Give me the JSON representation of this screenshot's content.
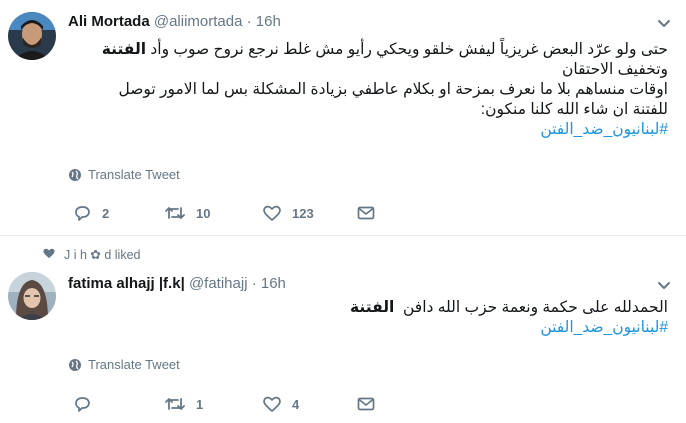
{
  "tweets": [
    {
      "name": "Ali Mortada",
      "handle": "@aliimortada",
      "time": "16h",
      "line1_prefix": "حتى ولو عرّد البعض غريزياً ليفش خلقو ويحكي رأيو مش غلط نرجع نروح صوب وأد",
      "line1_bold": "الفتنة",
      "line2": "وتخفيف الاحتقان",
      "line3": "اوقات منساهم بلا ما نعرف بمزحة او بكلام عاطفي بزيادة المشكلة بس لما الامور توصل",
      "line4": "للفتنة ان شاء الله كلنا منكون:",
      "hashtag": "#لبنانيون_ضد_الفتن",
      "translate": "Translate Tweet",
      "replies": "2",
      "retweets": "10",
      "likes": "123"
    },
    {
      "liked_by": "J i h ✿ d liked",
      "name": "fatima alhajj |f.k|",
      "handle": "@fatihajj",
      "time": "16h",
      "line1_prefix": "الحمدلله على حكمة ونعمة حزب الله دافن",
      "line1_bold": "الفتنة",
      "hashtag": "#لبنانيون_ضد_الفتن",
      "translate": "Translate Tweet",
      "replies": "",
      "retweets": "1",
      "likes": "4"
    }
  ],
  "colors": {
    "link": "#1b95e0",
    "muted": "#657786",
    "text": "#14171a",
    "divider": "#e6ecf0"
  },
  "icons": [
    "reply-icon",
    "retweet-icon",
    "like-icon",
    "message-icon",
    "globe-icon",
    "chevron-down-icon",
    "heart-icon"
  ]
}
